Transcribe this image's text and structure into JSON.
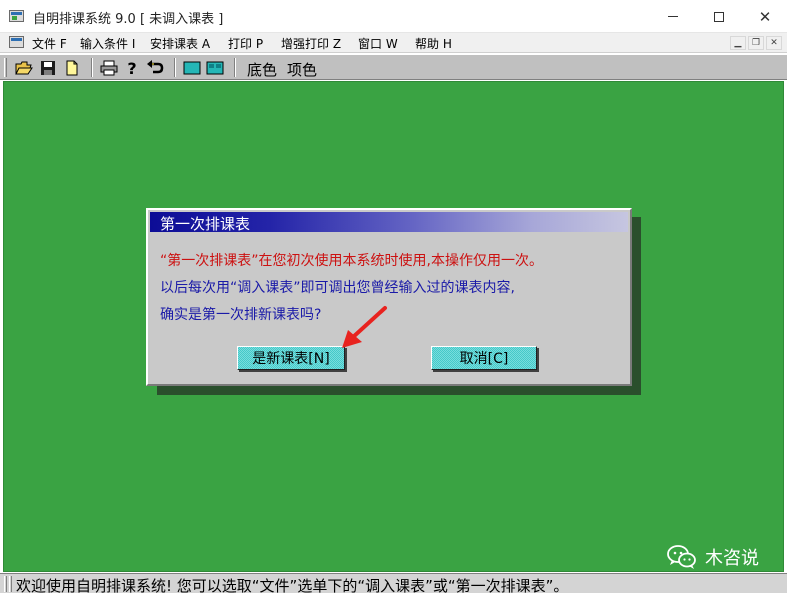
{
  "window": {
    "title": "自明排课系统 9.0 [ 未调入课表 ]"
  },
  "menu": {
    "items": [
      "文件 F",
      "输入条件 I",
      "安排课表 A",
      "打印 P",
      "增强打印 Z",
      "窗口 W",
      "帮助 H"
    ]
  },
  "toolbar": {
    "icons": [
      "open-folder-icon",
      "save-icon",
      "new-file-icon",
      "print-icon",
      "help-icon",
      "undo-icon",
      "view-icon-1",
      "view-icon-2"
    ],
    "bg_color_label": "底色",
    "fg_color_label": "项色"
  },
  "colors": {
    "workspace": "#3aa343",
    "dialog_title_start": "#0c0c96",
    "warning_text": "#cc1111",
    "info_text": "#1a1aa8",
    "button_face": "#45c9c9",
    "arrow": "#e8231f"
  },
  "dialog": {
    "title": "第一次排课表",
    "line1": "“第一次排课表”在您初次使用本系统时使用,本操作仅用一次。",
    "line2": "以后每次用“调入课表”即可调出您曾经输入过的课表内容,",
    "line3": "确实是第一次排新课表吗?",
    "ok_button": "是新课表[N]",
    "cancel_button": "取消[C]"
  },
  "watermark": {
    "text": "木咨说",
    "icon": "wechat-icon"
  },
  "status": {
    "text": "欢迎使用自明排课系统! 您可以选取“文件”选单下的“调入课表”或“第一次排课表”。"
  }
}
